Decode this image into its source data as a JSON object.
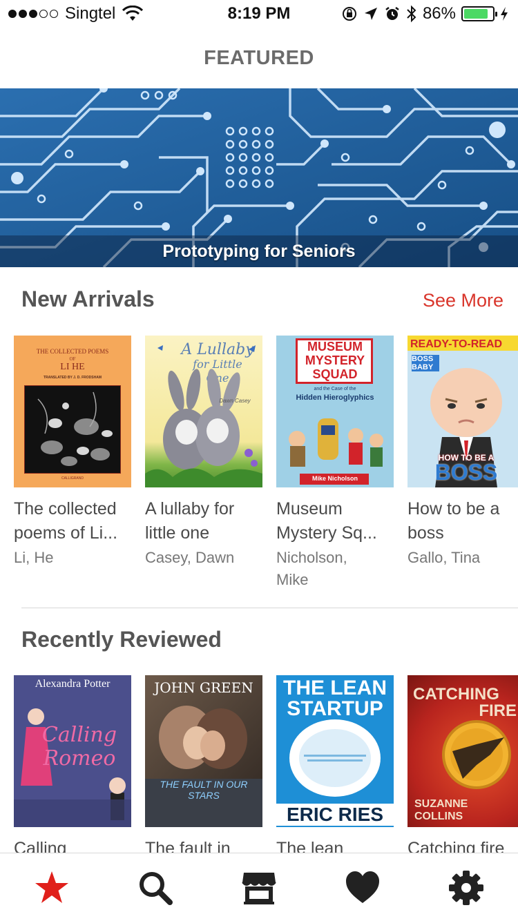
{
  "status_bar": {
    "carrier": "Singtel",
    "time": "8:19 PM",
    "battery": "86%",
    "battery_level": 0.86
  },
  "header": {
    "title": "FEATURED"
  },
  "featured": {
    "caption": "Prototyping for Seniors"
  },
  "new_arrivals": {
    "title": "New Arrivals",
    "see_more": "See More",
    "books": [
      {
        "title": "The collected poems of Li...",
        "author": "Li, He"
      },
      {
        "title": "A lullaby for little one",
        "author": "Casey, Dawn"
      },
      {
        "title": "Museum Mystery Sq...",
        "author": "Nicholson, Mike"
      },
      {
        "title": "How to be a boss",
        "author": "Gallo, Tina"
      }
    ]
  },
  "recently_reviewed": {
    "title": "Recently Reviewed",
    "books": [
      {
        "title": "Calling"
      },
      {
        "title": "The fault in"
      },
      {
        "title": "The lean"
      },
      {
        "title": "Catching fire"
      }
    ]
  },
  "covers": {
    "li_he_1": "THE COLLECTED POEMS",
    "li_he_2": "OF",
    "li_he_3": "LI HE",
    "li_he_4": "TRANSLATED BY J. D. FRODSHAM",
    "li_he_5": "CALLIGRAND",
    "lullaby_1": "A Lullaby",
    "lullaby_2": "for Little",
    "lullaby_3": "One",
    "lullaby_4": "Dawn Casey",
    "museum_1": "MUSEUM",
    "museum_2": "MYSTERY",
    "museum_3": "SQUAD",
    "museum_4": "and the Case of the",
    "museum_5": "Hidden Hieroglyphics",
    "museum_6": "Mike Nicholson",
    "boss_1": "READY-TO-READ",
    "boss_2": "BOSS BABY",
    "boss_3": "HOW TO BE A",
    "boss_4": "BOSS",
    "romeo_1": "Alexandra Potter",
    "romeo_2": "Calling Romeo",
    "fault_1": "JOHN GREEN",
    "fault_2": "THE FAULT IN OUR STARS",
    "lean_1": "THE LEAN",
    "lean_2": "STARTUP",
    "lean_3": "ERIC RIES",
    "fire_1": "CATCHING",
    "fire_2": "FIRE",
    "fire_3": "SUZANNE",
    "fire_4": "COLLINS"
  },
  "tabs": [
    {
      "name": "featured",
      "icon": "star-icon",
      "active": true
    },
    {
      "name": "search",
      "icon": "search-icon"
    },
    {
      "name": "store",
      "icon": "store-icon"
    },
    {
      "name": "favorites",
      "icon": "heart-icon"
    },
    {
      "name": "settings",
      "icon": "gear-icon"
    }
  ],
  "colors": {
    "accent": "#d9352b",
    "battery": "#4cd964",
    "banner": "#1e5f9c"
  }
}
